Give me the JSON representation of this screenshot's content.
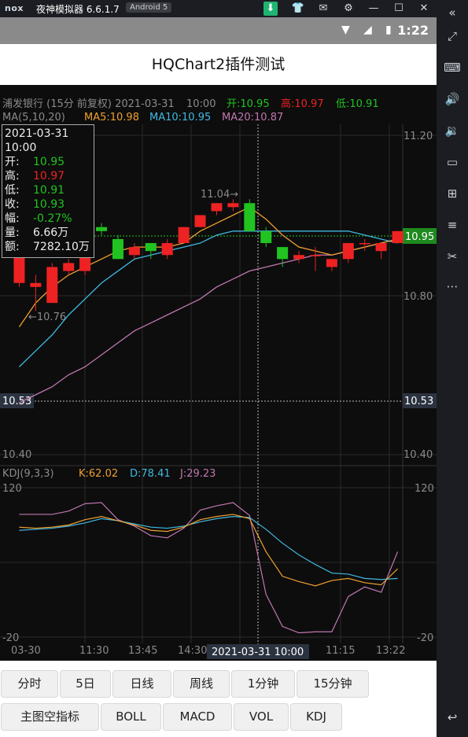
{
  "emulator": {
    "logo": "nox",
    "title": "夜神模拟器 6.6.1.7",
    "android_badge": "Android 5"
  },
  "status_bar": {
    "time": "1:22"
  },
  "app": {
    "title": "HQChart2插件测试"
  },
  "chart_header": {
    "stock": "浦发银行 (15分 前复权) 2021-03-31",
    "time": "10:00",
    "open": "开:10.95",
    "high": "高:10.97",
    "low": "低:10.91",
    "ma_label": "MA(5,10,20)",
    "ma5": "MA5:10.98",
    "ma10": "MA10:10.95",
    "ma20": "MA20:10.87"
  },
  "tooltip": {
    "date": "2021-03-31",
    "time": "10:00",
    "rows": [
      {
        "label": "开:",
        "value": "10.95",
        "color": "#21c321"
      },
      {
        "label": "高:",
        "value": "10.97",
        "color": "#ee2222"
      },
      {
        "label": "低:",
        "value": "10.91",
        "color": "#21c321"
      },
      {
        "label": "收:",
        "value": "10.93",
        "color": "#21c321"
      },
      {
        "label": "幅:",
        "value": "-0.27%",
        "color": "#21c321"
      },
      {
        "label": "量:",
        "value": "6.66万",
        "color": "#eeeeee"
      },
      {
        "label": "额:",
        "value": "7282.10万",
        "color": "#eeeeee"
      }
    ]
  },
  "kline_axis": {
    "right_ticks": [
      "11.20",
      "10.80",
      "10.40"
    ],
    "left_tick": "10.40",
    "crosshair_price": "10.53",
    "last_price": "10.95",
    "max_label": "11.04→",
    "min_label": "←10.76"
  },
  "kdj": {
    "label": "KDJ(9,3,3)",
    "k": "K:62.02",
    "d": "D:78.41",
    "j": "J:29.23",
    "ticks": [
      "120",
      "-20"
    ]
  },
  "x_axis": {
    "labels": [
      "03-30",
      "11:30",
      "13:45",
      "14:30",
      "11:15",
      "13:22"
    ],
    "crosshair_label": "2021-03-31 10:00"
  },
  "buttons_row1": [
    "分时",
    "5日",
    "日线",
    "周线",
    "1分钟",
    "15分钟"
  ],
  "buttons_row2": [
    "主图空指标",
    "BOLL",
    "MACD",
    "VOL",
    "KDJ"
  ],
  "chart_data": {
    "type": "candlestick",
    "price_range": [
      10.4,
      11.2
    ],
    "kdj_range": [
      -20,
      120
    ],
    "candles": [
      {
        "o": 10.83,
        "c": 10.93,
        "h": 10.95,
        "l": 10.82
      },
      {
        "o": 10.82,
        "c": 10.83,
        "h": 10.85,
        "l": 10.76
      },
      {
        "o": 10.78,
        "c": 10.87,
        "h": 10.88,
        "l": 10.78
      },
      {
        "o": 10.86,
        "c": 10.88,
        "h": 10.89,
        "l": 10.85
      },
      {
        "o": 10.86,
        "c": 10.95,
        "h": 10.96,
        "l": 10.85
      },
      {
        "o": 10.97,
        "c": 10.96,
        "h": 10.98,
        "l": 10.95
      },
      {
        "o": 10.94,
        "c": 10.89,
        "h": 10.95,
        "l": 10.89
      },
      {
        "o": 10.9,
        "c": 10.92,
        "h": 10.93,
        "l": 10.89
      },
      {
        "o": 10.93,
        "c": 10.91,
        "h": 10.93,
        "l": 10.89
      },
      {
        "o": 10.9,
        "c": 10.93,
        "h": 10.94,
        "l": 10.89
      },
      {
        "o": 10.93,
        "c": 10.97,
        "h": 10.97,
        "l": 10.93
      },
      {
        "o": 10.97,
        "c": 11.0,
        "h": 11.0,
        "l": 10.97
      },
      {
        "o": 11.01,
        "c": 11.03,
        "h": 11.03,
        "l": 11.0
      },
      {
        "o": 11.02,
        "c": 11.03,
        "h": 11.04,
        "l": 11.01
      },
      {
        "o": 11.03,
        "c": 10.96,
        "h": 11.04,
        "l": 10.96
      },
      {
        "o": 10.96,
        "c": 10.93,
        "h": 10.97,
        "l": 10.92
      },
      {
        "o": 10.92,
        "c": 10.89,
        "h": 10.92,
        "l": 10.87
      },
      {
        "o": 10.89,
        "c": 10.9,
        "h": 10.91,
        "l": 10.88
      },
      {
        "o": 10.9,
        "c": 10.9,
        "h": 10.92,
        "l": 10.86
      },
      {
        "o": 10.87,
        "c": 10.89,
        "h": 10.89,
        "l": 10.86
      },
      {
        "o": 10.89,
        "c": 10.93,
        "h": 10.93,
        "l": 10.88
      },
      {
        "o": 10.93,
        "c": 10.93,
        "h": 10.94,
        "l": 10.91
      },
      {
        "o": 10.91,
        "c": 10.93,
        "h": 10.93,
        "l": 10.89
      },
      {
        "o": 10.93,
        "c": 10.96,
        "h": 10.96,
        "l": 10.93
      }
    ],
    "ma5": [
      10.72,
      10.78,
      10.82,
      10.85,
      10.87,
      10.89,
      10.91,
      10.92,
      10.92,
      10.92,
      10.93,
      10.96,
      10.98,
      11.0,
      11.02,
      10.99,
      10.95,
      10.92,
      10.91,
      10.9,
      10.91,
      10.92,
      10.93,
      10.94
    ],
    "ma10": [
      10.62,
      10.66,
      10.7,
      10.75,
      10.79,
      10.83,
      10.86,
      10.89,
      10.9,
      10.91,
      10.92,
      10.93,
      10.95,
      10.96,
      10.96,
      10.96,
      10.96,
      10.96,
      10.96,
      10.96,
      10.96,
      10.95,
      10.94,
      10.93
    ],
    "ma20": [
      10.53,
      10.55,
      10.57,
      10.6,
      10.62,
      10.65,
      10.68,
      10.71,
      10.73,
      10.75,
      10.77,
      10.79,
      10.82,
      10.84,
      10.86,
      10.87,
      10.88,
      10.89,
      10.9,
      10.9,
      10.91,
      10.92,
      10.93,
      10.94
    ],
    "kdj_k": [
      83,
      82,
      83,
      85,
      90,
      93,
      89,
      85,
      80,
      79,
      83,
      90,
      93,
      95,
      91,
      60,
      37,
      32,
      28,
      33,
      35,
      31,
      29,
      44
    ],
    "kdj_d": [
      80,
      81,
      82,
      84,
      87,
      91,
      89,
      86,
      83,
      82,
      84,
      88,
      91,
      93,
      92,
      81,
      68,
      57,
      48,
      40,
      39,
      35,
      34,
      35
    ],
    "kdj_j": [
      95,
      95,
      95,
      98,
      105,
      106,
      90,
      84,
      75,
      73,
      82,
      99,
      103,
      106,
      94,
      20,
      -10,
      -16,
      -15,
      -15,
      18,
      27,
      22,
      60
    ]
  }
}
